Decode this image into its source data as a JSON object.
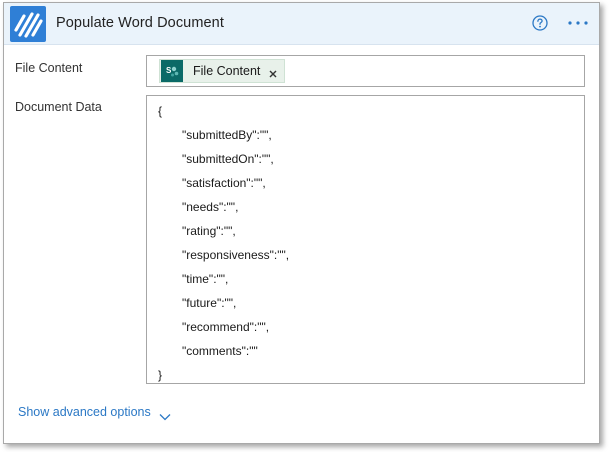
{
  "header": {
    "title": "Populate Word Document",
    "logo_icon": "word-online-connector-icon",
    "help_icon": "help-circle-icon",
    "more_icon": "more-horizontal-icon",
    "background": "#eaf3fb",
    "logo_color": "#2f7fd6"
  },
  "fields": {
    "file_content": {
      "label": "File Content",
      "token": {
        "icon": "sharepoint-icon",
        "label": "File Content",
        "remove_glyph": "×",
        "color": "#0b6a67"
      }
    },
    "document_data": {
      "label": "Document Data",
      "lines": [
        "{",
        "\"submittedBy\":\"\",",
        "\"submittedOn\":\"\",",
        "\"satisfaction\":\"\",",
        "\"needs\":\"\",",
        "\"rating\":\"\",",
        "\"responsiveness\":\"\",",
        "\"time\":\"\",",
        "\"future\":\"\",",
        "\"recommend\":\"\",",
        "\"comments\":\"\"",
        "}"
      ]
    }
  },
  "footer": {
    "advanced_label": "Show advanced options",
    "advanced_icon": "chevron-down-icon",
    "link_color": "#2b78c5"
  }
}
